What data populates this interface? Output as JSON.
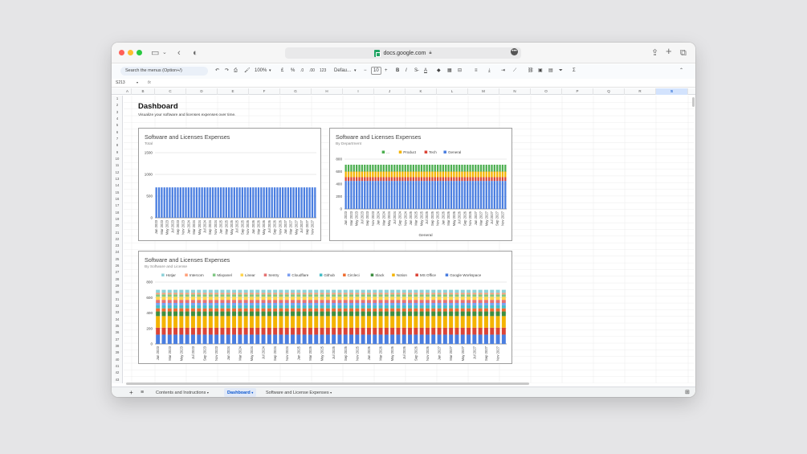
{
  "browser": {
    "url": "docs.google.com"
  },
  "toolbar": {
    "search_placeholder": "Search the menus (Option+/)",
    "zoom": "100%",
    "currency": "£",
    "percent": "%",
    "dec_decrease": ".0",
    "dec_increase": ".00",
    "number_format": "123",
    "font": "Defau...",
    "font_size": "10",
    "minus": "−",
    "plus": "+",
    "bold": "B",
    "italic": "I"
  },
  "formula_bar": {
    "cell_ref": "S213",
    "fx": "fx"
  },
  "columns": [
    "A",
    "B",
    "C",
    "D",
    "E",
    "F",
    "G",
    "H",
    "I",
    "J",
    "K",
    "L",
    "M",
    "N",
    "O",
    "P",
    "Q",
    "R",
    "S"
  ],
  "rows": [
    "1",
    "2",
    "3",
    "4",
    "5",
    "6",
    "7",
    "8",
    "9",
    "10",
    "11",
    "12",
    "13",
    "14",
    "15",
    "16",
    "17",
    "18",
    "19",
    "20",
    "21",
    "22",
    "23",
    "24",
    "25",
    "26",
    "27",
    "28",
    "29",
    "30",
    "31",
    "32",
    "33",
    "34",
    "35",
    "36",
    "37",
    "38",
    "39",
    "40",
    "41",
    "42",
    "43"
  ],
  "sheet": {
    "title": "Dashboard",
    "subtitle": "Visualize your software and licenses expenses over time."
  },
  "months": [
    "Jan 2023",
    "Feb 2023",
    "Mar 2023",
    "Apr 2023",
    "May 2023",
    "Jun 2023",
    "Jul 2023",
    "Aug 2023",
    "Sep 2023",
    "Oct 2023",
    "Nov 2023",
    "Dec 2023",
    "Jan 2024",
    "Feb 2024",
    "Mar 2024",
    "Apr 2024",
    "May 2024",
    "Jun 2024",
    "Jul 2024",
    "Aug 2024",
    "Sep 2024",
    "Oct 2024",
    "Nov 2024",
    "Dec 2024",
    "Jan 2025",
    "Feb 2025",
    "Mar 2025",
    "Apr 2025",
    "May 2025",
    "Jun 2025",
    "Jul 2025",
    "Aug 2025",
    "Sep 2025",
    "Oct 2025",
    "Nov 2025",
    "Dec 2025",
    "Jan 2026",
    "Feb 2026",
    "Mar 2026",
    "Apr 2026",
    "May 2026",
    "Jun 2026",
    "Jul 2026",
    "Aug 2026",
    "Sep 2026",
    "Oct 2026",
    "Nov 2026",
    "Dec 2026",
    "Jan 2027",
    "Feb 2027",
    "Mar 2027",
    "Apr 2027",
    "May 2027",
    "Jun 2027",
    "Jul 2027",
    "Aug 2027",
    "Sep 2027",
    "Oct 2027",
    "Nov 2027",
    "Dec 2027"
  ],
  "chart_data": [
    {
      "type": "bar",
      "title": "Software and Licenses Expenses",
      "subtitle": "Total",
      "xlabel": "",
      "ylabel": "",
      "ylim": [
        0,
        1500
      ],
      "yticks": [
        0,
        500,
        1000,
        1500
      ],
      "label_step": 2,
      "series": [
        {
          "name": "",
          "color": "#4a7ee0",
          "constant": 700
        }
      ],
      "grid": true,
      "legend": ""
    },
    {
      "type": "bar",
      "stacked": true,
      "title": "Software and Licenses Expenses",
      "subtitle": "By Department",
      "xlabel": "General",
      "ylabel": "",
      "ylim": [
        0,
        800
      ],
      "yticks": [
        0,
        200,
        400,
        600,
        800
      ],
      "label_step": 2,
      "legend": "top",
      "series": [
        {
          "name": "General",
          "color": "#4a7ee0",
          "constant": 450
        },
        {
          "name": "Tech",
          "color": "#db4437",
          "constant": 60
        },
        {
          "name": "Product",
          "color": "#f4b400",
          "constant": 90
        },
        {
          "name": "...",
          "color": "#4caf50",
          "constant": 110
        }
      ],
      "legend_order": [
        "...",
        "Product",
        "Tech",
        "General"
      ],
      "grid": true
    },
    {
      "type": "bar",
      "stacked": true,
      "title": "Software and Licenses Expenses",
      "subtitle": "By Software and License",
      "xlabel": "",
      "ylabel": "",
      "ylim": [
        0,
        800
      ],
      "yticks": [
        0,
        200,
        400,
        600,
        800
      ],
      "label_step": 2,
      "legend": "top",
      "series": [
        {
          "name": "Google Workspace",
          "color": "#4a7ee0",
          "constant": 120
        },
        {
          "name": "MS Office",
          "color": "#db4437",
          "constant": 90
        },
        {
          "name": "Notion",
          "color": "#f4b400",
          "constant": 150
        },
        {
          "name": "Slack",
          "color": "#3e8e41",
          "constant": 60
        },
        {
          "name": "Circleci",
          "color": "#ef6c2f",
          "constant": 40
        },
        {
          "name": "Github",
          "color": "#46bdc6",
          "constant": 40
        },
        {
          "name": "Cloudflare",
          "color": "#7b9ef0",
          "constant": 30
        },
        {
          "name": "Sentry",
          "color": "#e57373",
          "constant": 40
        },
        {
          "name": "Linear",
          "color": "#ffd54f",
          "constant": 40
        },
        {
          "name": "Mixpanel",
          "color": "#81c784",
          "constant": 30
        },
        {
          "name": "Intercom",
          "color": "#ffa07a",
          "constant": 20
        },
        {
          "name": "Hotjar",
          "color": "#8ed1d8",
          "constant": 40
        }
      ],
      "legend_order": [
        "Hotjar",
        "Intercom",
        "Mixpanel",
        "Linear",
        "Sentry",
        "Cloudflare",
        "Github",
        "Circleci",
        "Slack",
        "Notion",
        "MS Office",
        "Google Workspace"
      ],
      "grid": true
    }
  ],
  "tabs": [
    {
      "label": "Contents and Instructions",
      "active": false
    },
    {
      "label": "Dashboard",
      "active": true
    },
    {
      "label": "Software and License Expenses",
      "active": false
    }
  ],
  "tab_bar": {
    "add": "+",
    "menu": "≡"
  },
  "colors": {
    "accent": "#0b57d0",
    "active_tab_bg": "#e1e9f7"
  }
}
